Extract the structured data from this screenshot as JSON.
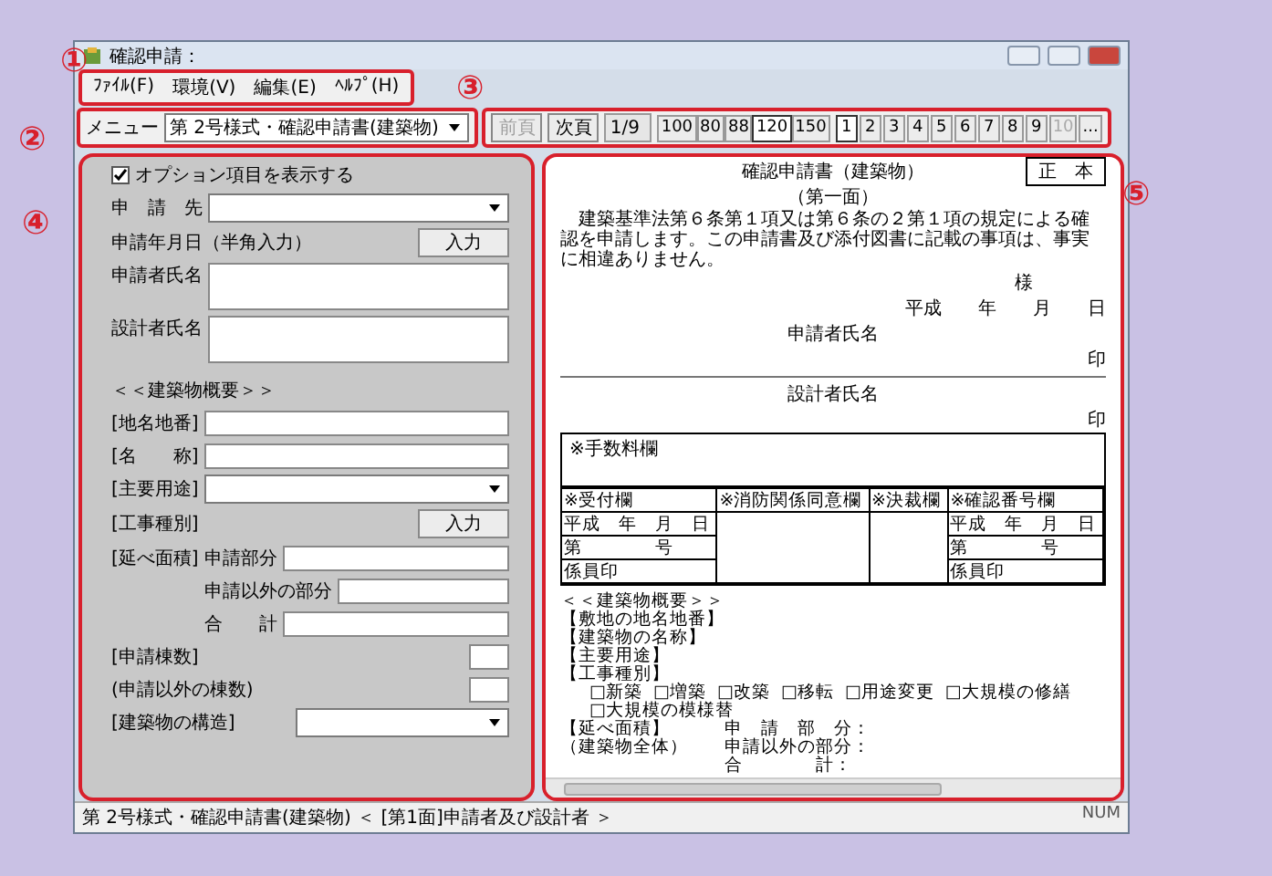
{
  "window": {
    "title": "確認申請："
  },
  "annotations": [
    "①",
    "②",
    "③",
    "④",
    "⑤"
  ],
  "menu": [
    "ﾌｧｲﾙ(F)",
    "環境(V)",
    "編集(E)",
    "ﾍﾙﾌﾟ(H)"
  ],
  "toolbar": {
    "menu_label": "メニュー",
    "form_select": "第 2号様式・確認申請書(建築物)",
    "prev": {
      "label": "前頁",
      "disabled": true
    },
    "next": {
      "label": "次頁",
      "disabled": false
    },
    "page": "1/9",
    "zoom": [
      {
        "label": "100",
        "selected": false
      },
      {
        "label": "80",
        "selected": false
      },
      {
        "label": "88",
        "selected": false
      },
      {
        "label": "120",
        "selected": true
      },
      {
        "label": "150",
        "selected": false
      }
    ],
    "pages": [
      {
        "label": "1",
        "selected": true,
        "disabled": false
      },
      {
        "label": "2",
        "selected": false,
        "disabled": false
      },
      {
        "label": "3",
        "selected": false,
        "disabled": false
      },
      {
        "label": "4",
        "selected": false,
        "disabled": false
      },
      {
        "label": "5",
        "selected": false,
        "disabled": false
      },
      {
        "label": "6",
        "selected": false,
        "disabled": false
      },
      {
        "label": "7",
        "selected": false,
        "disabled": false
      },
      {
        "label": "8",
        "selected": false,
        "disabled": false
      },
      {
        "label": "9",
        "selected": false,
        "disabled": false
      },
      {
        "label": "10",
        "selected": false,
        "disabled": true
      },
      {
        "label": "...",
        "selected": false,
        "disabled": false
      }
    ]
  },
  "form": {
    "option": {
      "label": "オプション項目を表示する",
      "checked": true
    },
    "rows": [
      {
        "kind": "select",
        "label": "申　請　先"
      },
      {
        "kind": "button",
        "label": "申請年月日（半角入力）",
        "button": "入力"
      },
      {
        "kind": "textarea",
        "label": "申請者氏名"
      },
      {
        "kind": "textarea",
        "label": "設計者氏名"
      },
      {
        "kind": "heading",
        "label": "＜＜建築物概要＞＞"
      },
      {
        "kind": "text",
        "label": "[地名地番]"
      },
      {
        "kind": "text",
        "label": "[名　　称]"
      },
      {
        "kind": "select",
        "label": "[主要用途]"
      },
      {
        "kind": "button",
        "label": "[工事種別]",
        "button": "入力"
      },
      {
        "kind": "area",
        "label": "[延べ面積]",
        "parts": [
          "申請部分",
          "申請以外の部分",
          "合　　計"
        ]
      },
      {
        "kind": "small",
        "label": "[申請棟数]"
      },
      {
        "kind": "small",
        "label": "(申請以外の棟数)"
      },
      {
        "kind": "wideselect",
        "label": "[建築物の構造]"
      }
    ]
  },
  "document": {
    "title": "確認申請書（建築物）",
    "stamp": "正　本",
    "page_label": "（第一面）",
    "statement": "建築基準法第６条第１項又は第６条の２第１項の規定による確認を申請します。この申請書及び添付図書に記載の事項は、事実に相違ありません。",
    "addressee": "様",
    "date": "平成　　年　　月　　日",
    "applicant": "申請者氏名",
    "applicant_seal": "印",
    "designer": "設計者氏名",
    "designer_seal": "印",
    "fee": "※手数料欄",
    "table_headers": [
      "※受付欄",
      "※消防関係同意欄",
      "※決裁欄",
      "※確認番号欄"
    ],
    "table_left": [
      "平成　年　月　日",
      "第　　　　号",
      "係員印"
    ],
    "table_right": [
      "平成　年　月　日",
      "第　　　　号",
      "係員印"
    ],
    "summary": [
      "＜＜建築物概要＞＞",
      "【敷地の地名地番】",
      "【建築物の名称】",
      "【主要用途】",
      "【工事種別】"
    ],
    "work_types": [
      "□新築",
      "□増築",
      "□改築",
      "□移転",
      "□用途変更",
      "□大規模の修繕",
      "□大規模の模様替"
    ],
    "area_label": "【延べ面積】",
    "area_sub": "（建築物全体）",
    "area_parts": [
      "申　請　部　分：",
      "申請以外の部分：",
      "合　　　　計："
    ]
  },
  "status_bar": {
    "text": "第 2号様式・確認申請書(建築物) ＜ [第1面]申請者及び設計者 ＞",
    "mode": "NUM"
  }
}
